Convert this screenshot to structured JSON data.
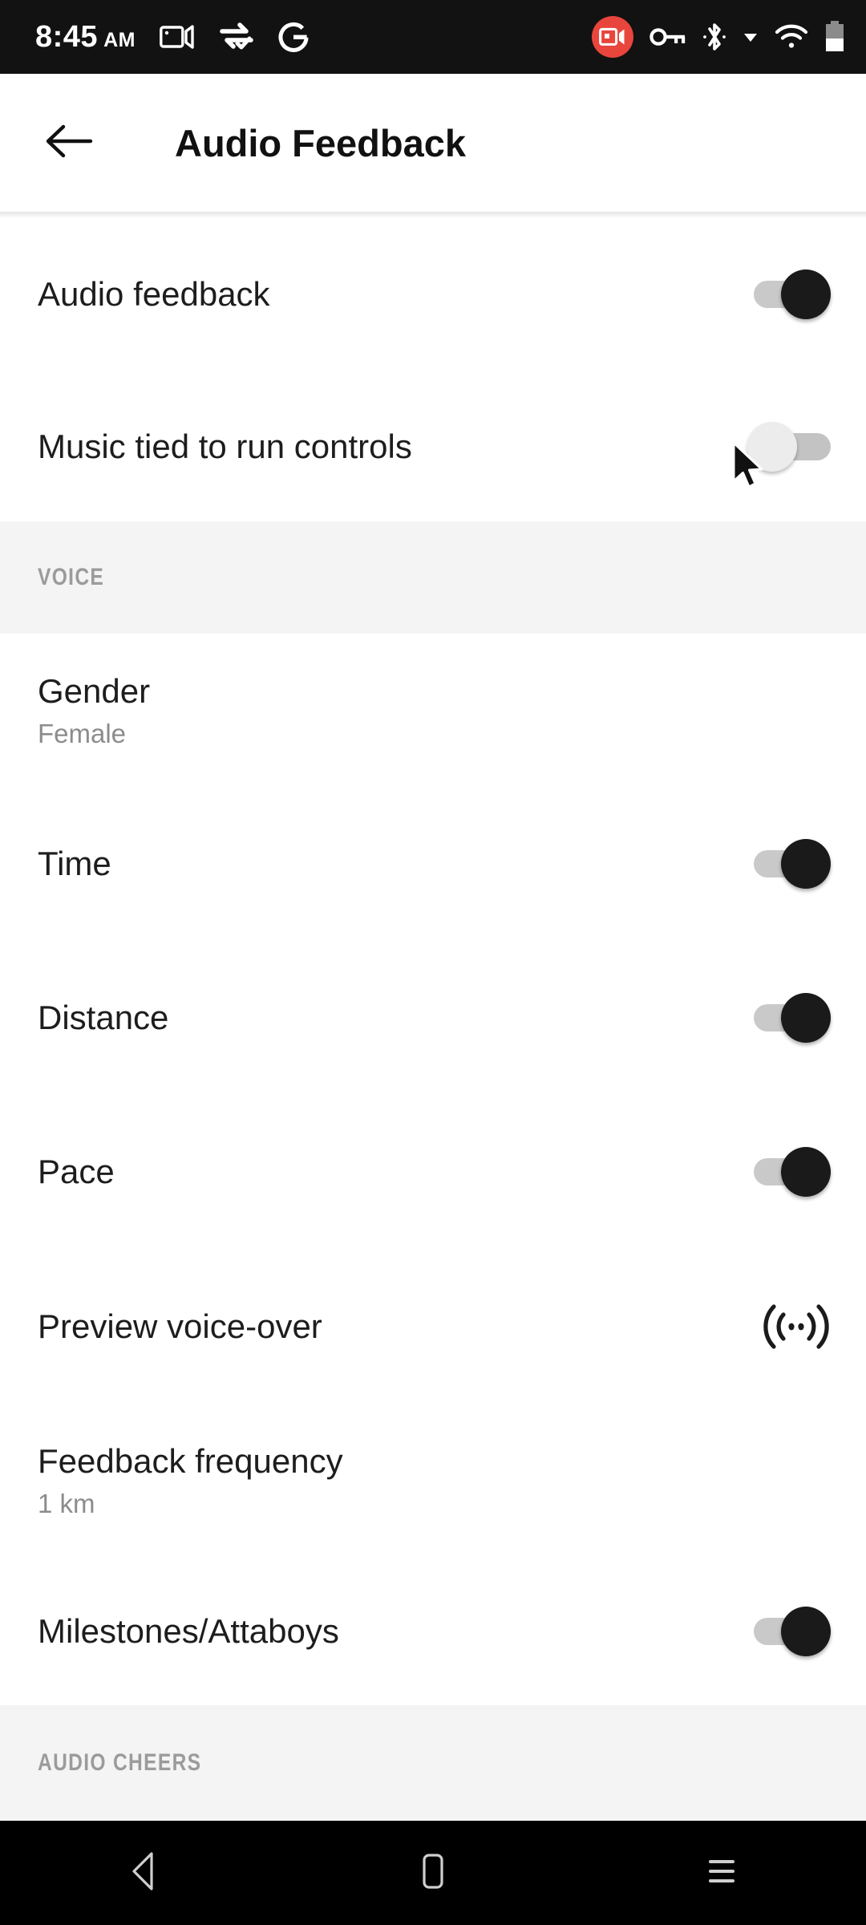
{
  "status_bar": {
    "time": "8:45",
    "ampm": "AM",
    "left_icons": [
      {
        "name": "video-camera-icon"
      },
      {
        "name": "data-transfer-verified-icon"
      },
      {
        "name": "google-g-icon"
      }
    ],
    "right_icons": [
      {
        "name": "screen-recording-icon"
      },
      {
        "name": "vpn-key-icon"
      },
      {
        "name": "bluetooth-icon"
      },
      {
        "name": "dropdown-triangle-icon"
      },
      {
        "name": "wifi-icon"
      },
      {
        "name": "battery-icon"
      }
    ]
  },
  "app_bar": {
    "back_icon": "arrow-left-icon",
    "title": "Audio Feedback"
  },
  "settings": [
    {
      "kind": "toggle",
      "title": "Audio feedback",
      "state": "on"
    },
    {
      "kind": "toggle",
      "title": "Music tied to run controls",
      "state": "off"
    },
    {
      "kind": "section",
      "title": "VOICE"
    },
    {
      "kind": "value",
      "title": "Gender",
      "value": "Female"
    },
    {
      "kind": "toggle",
      "title": "Time",
      "state": "on"
    },
    {
      "kind": "toggle",
      "title": "Distance",
      "state": "on"
    },
    {
      "kind": "toggle",
      "title": "Pace",
      "state": "on"
    },
    {
      "kind": "action",
      "title": "Preview voice-over",
      "icon": "broadcast-wave-icon"
    },
    {
      "kind": "value",
      "title": "Feedback frequency",
      "value": "1 km"
    },
    {
      "kind": "toggle",
      "title": "Milestones/Attaboys",
      "state": "on"
    },
    {
      "kind": "section",
      "title": "AUDIO CHEERS"
    }
  ],
  "cursor": {
    "name": "mouse-pointer"
  },
  "nav_bar": {
    "back": "nav-back-icon",
    "home": "nav-home-icon",
    "recents": "nav-recents-icon"
  },
  "colors": {
    "accent_record": "#e8453c",
    "toggle_on_knob": "#1a1a1a",
    "toggle_track": "#c9c9c9",
    "section_bg": "#f4f4f4",
    "subtitle": "#8c8c8c"
  }
}
